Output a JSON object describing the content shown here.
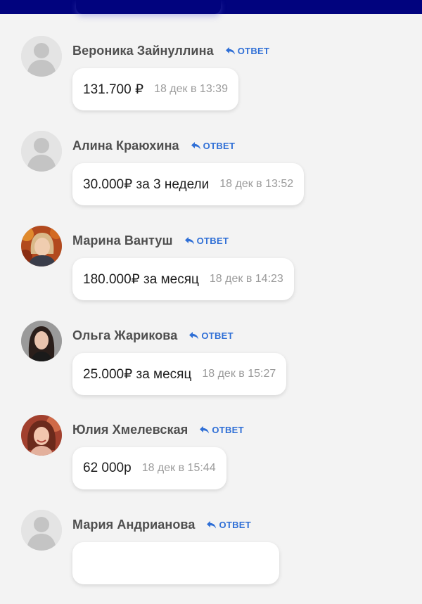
{
  "comments": [
    {
      "name": "Вероника Зайнуллина",
      "reply": "ОТВЕТ",
      "text": "131.700 ₽",
      "time": "18 дек в 13:39",
      "avatar": "default-avatar"
    },
    {
      "name": "Алина Краюхина",
      "reply": "ОТВЕТ",
      "text": "30.000₽ за 3 недели",
      "time": "18 дек в 13:52",
      "avatar": "default-avatar"
    },
    {
      "name": "Марина Вантуш",
      "reply": "ОТВЕТ",
      "text": "180.000₽ за месяц",
      "time": "18 дек в 14:23",
      "avatar": "photo-avatar"
    },
    {
      "name": "Ольга Жарикова",
      "reply": "ОТВЕТ",
      "text": "25.000₽ за месяц",
      "time": "18 дек в 15:27",
      "avatar": "photo-avatar"
    },
    {
      "name": "Юлия Хмелевская",
      "reply": "ОТВЕТ",
      "text": "62 000р",
      "time": "18 дек в 15:44",
      "avatar": "photo-avatar"
    },
    {
      "name": "Мария Андрианова",
      "reply": "ОТВЕТ",
      "text": "",
      "time": "",
      "avatar": "default-avatar"
    }
  ],
  "colors": {
    "header": "#01037e",
    "accent": "#2f6fd6",
    "background": "#f3f3f3"
  }
}
